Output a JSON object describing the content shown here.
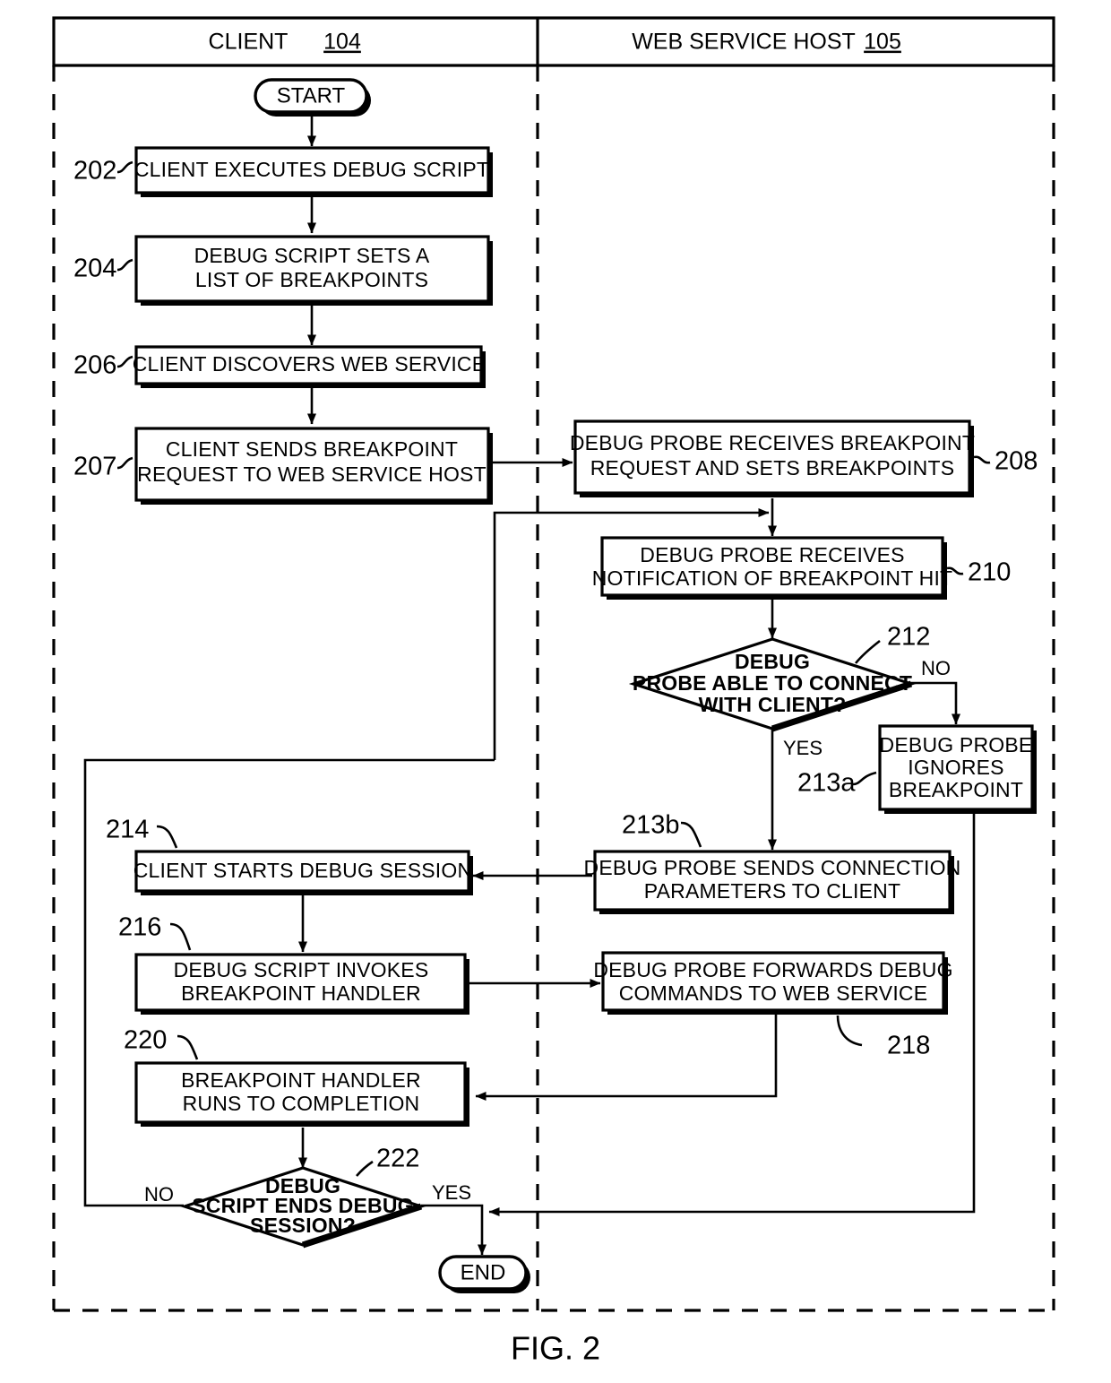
{
  "figure": {
    "caption": "FIG. 2"
  },
  "lanes": [
    {
      "id": "client",
      "title": "CLIENT",
      "ref": "104"
    },
    {
      "id": "web_service_host",
      "title": "WEB SERVICE HOST",
      "ref": "105"
    }
  ],
  "terminals": {
    "start": "START",
    "end": "END"
  },
  "nodes": [
    {
      "id": "n202",
      "ref": "202",
      "lane": "client",
      "shape": "process",
      "lines": [
        "CLIENT EXECUTES DEBUG SCRIPT"
      ]
    },
    {
      "id": "n204",
      "ref": "204",
      "lane": "client",
      "shape": "process",
      "lines": [
        "DEBUG SCRIPT SETS A",
        "LIST OF BREAKPOINTS"
      ]
    },
    {
      "id": "n206",
      "ref": "206",
      "lane": "client",
      "shape": "process",
      "lines": [
        "CLIENT DISCOVERS WEB SERVICE"
      ]
    },
    {
      "id": "n207",
      "ref": "207",
      "lane": "client",
      "shape": "process",
      "lines": [
        "CLIENT SENDS BREAKPOINT",
        "REQUEST TO WEB SERVICE HOST"
      ]
    },
    {
      "id": "n208",
      "ref": "208",
      "lane": "web_service_host",
      "shape": "process",
      "lines": [
        "DEBUG PROBE RECEIVES BREAKPOINT",
        "REQUEST AND SETS BREAKPOINTS"
      ]
    },
    {
      "id": "n210",
      "ref": "210",
      "lane": "web_service_host",
      "shape": "process",
      "lines": [
        "DEBUG PROBE RECEIVES",
        "NOTIFICATION OF BREAKPOINT HIT"
      ]
    },
    {
      "id": "n212",
      "ref": "212",
      "lane": "web_service_host",
      "shape": "decision",
      "lines": [
        "DEBUG",
        "PROBE ABLE TO CONNECT",
        "WITH  CLIENT?"
      ]
    },
    {
      "id": "n213a",
      "ref": "213a",
      "lane": "web_service_host",
      "shape": "process",
      "lines": [
        "DEBUG PROBE",
        "IGNORES",
        "BREAKPOINT"
      ]
    },
    {
      "id": "n213b",
      "ref": "213b",
      "lane": "web_service_host",
      "shape": "process",
      "lines": [
        "DEBUG PROBE SENDS CONNECTION",
        "PARAMETERS TO CLIENT"
      ]
    },
    {
      "id": "n214",
      "ref": "214",
      "lane": "client",
      "shape": "process",
      "lines": [
        "CLIENT STARTS DEBUG SESSION"
      ]
    },
    {
      "id": "n216",
      "ref": "216",
      "lane": "client",
      "shape": "process",
      "lines": [
        "DEBUG SCRIPT INVOKES",
        "BREAKPOINT HANDLER"
      ]
    },
    {
      "id": "n218",
      "ref": "218",
      "lane": "web_service_host",
      "shape": "process",
      "lines": [
        "DEBUG PROBE FORWARDS DEBUG",
        "COMMANDS TO WEB SERVICE"
      ]
    },
    {
      "id": "n220",
      "ref": "220",
      "lane": "client",
      "shape": "process",
      "lines": [
        "BREAKPOINT HANDLER",
        "RUNS TO COMPLETION"
      ]
    },
    {
      "id": "n222",
      "ref": "222",
      "lane": "client",
      "shape": "decision",
      "lines": [
        "DEBUG",
        "SCRIPT ENDS DEBUG",
        "SESSION?"
      ]
    }
  ],
  "edge_labels": {
    "d212_no": "NO",
    "d212_yes": "YES",
    "d222_no": "NO",
    "d222_yes": "YES"
  },
  "colors": {
    "ink": "#000000",
    "paper": "#ffffff"
  }
}
